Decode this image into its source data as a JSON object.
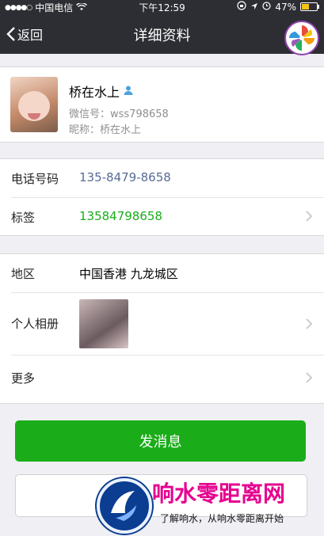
{
  "status_bar": {
    "carrier": "中国电信",
    "time": "下午12:59",
    "battery": "47%",
    "battery_level": 0.47
  },
  "nav": {
    "back_label": "返回",
    "title": "详细资料"
  },
  "profile": {
    "name": "桥在水上",
    "wechat_id": "微信号：wss798658",
    "nickname": "昵称：桥在水上"
  },
  "contact": {
    "phone_label": "电话号码",
    "phone_value": "135-8479-8658",
    "tag_label": "标签",
    "tag_value": "13584798658"
  },
  "details": {
    "region_label": "地区",
    "region_value": "中国香港 九龙城区",
    "album_label": "个人相册",
    "more_label": "更多"
  },
  "actions": {
    "send_message": "发消息"
  },
  "watermark": {
    "title": "响水零距离网",
    "subtitle": "了解响水，从响水零距离开始"
  },
  "colors": {
    "accent_green": "#1aad19",
    "phone_blue": "#576b95",
    "nav_bg": "#2d2e33"
  }
}
